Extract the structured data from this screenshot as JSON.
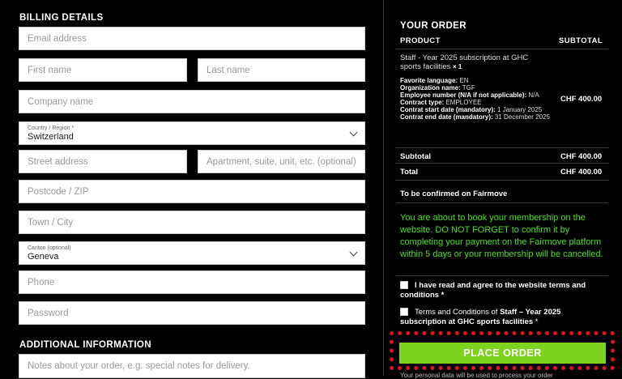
{
  "billing": {
    "heading": "BILLING DETAILS",
    "email_placeholder": "Email address",
    "first_name_placeholder": "First name",
    "last_name_placeholder": "Last name",
    "company_placeholder": "Company name",
    "country_label": "Country / Region *",
    "country_value": "Switzerland",
    "street_placeholder": "Street address",
    "apartment_placeholder": "Apartment, suite, unit, etc. (optional)",
    "postcode_placeholder": "Postcode / ZIP",
    "town_placeholder": "Town / City",
    "canton_label": "Canton (optional)",
    "canton_value": "Geneva",
    "phone_placeholder": "Phone",
    "password_placeholder": "Password"
  },
  "additional": {
    "heading": "ADDITIONAL INFORMATION",
    "notes_placeholder": "Notes about your order, e.g. special notes for delivery."
  },
  "order": {
    "heading": "YOUR ORDER",
    "col_product": "PRODUCT",
    "col_subtotal": "SUBTOTAL",
    "product_name": "Staff - Year 2025 subscription at GHC sports facilities",
    "product_qty": "× 1",
    "meta": [
      {
        "label": "Favorite language:",
        "value": "EN"
      },
      {
        "label": "Organization name:",
        "value": "TGF"
      },
      {
        "label": "Employee number (N/A if not applicable):",
        "value": "N/A"
      },
      {
        "label": "Contract type:",
        "value": "EMPLOYEE"
      },
      {
        "label": "Contrat start date (mandatory):",
        "value": "1 January 2025"
      },
      {
        "label": "Contrat end date (mandatory):",
        "value": "31 December 2025"
      }
    ],
    "product_price": "CHF 400.00",
    "subtotal_label": "Subtotal",
    "subtotal_value": "CHF 400.00",
    "total_label": "Total",
    "total_value": "CHF 400.00",
    "payment_method": "To be confirmed on Fairmove",
    "notice": "You are about to book your membership on the website. DO NOT FORGET to confirm it by completing your payment on the Fairmove platform within 5 days or your membership will be cancelled.",
    "terms_text": "I have read and agree to the website terms and conditions *",
    "tc_prefix": "Terms and Conditions of ",
    "tc_bold": "Staff – Year 2025 subscription at GHC sports facilities",
    "tc_suffix": " *",
    "place_order": "PLACE ORDER",
    "privacy_partial": "Your personal data will be used to process your order"
  }
}
